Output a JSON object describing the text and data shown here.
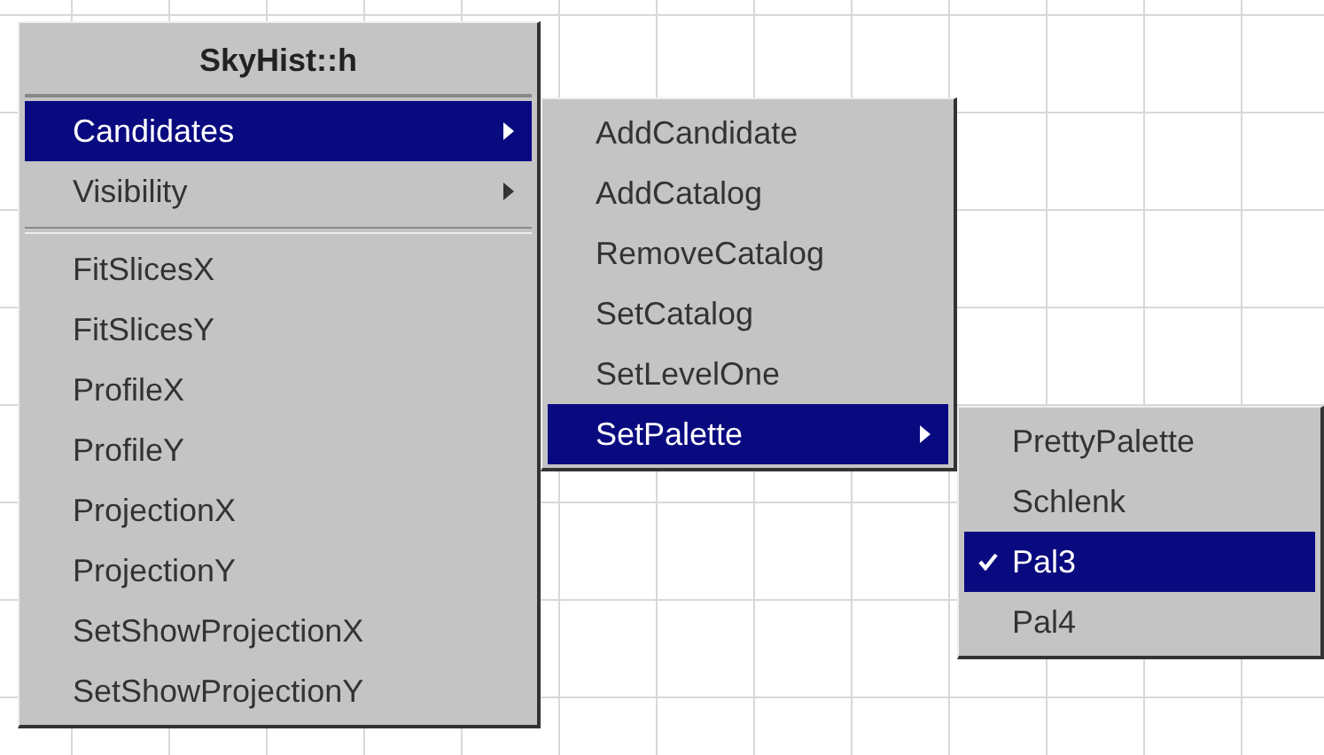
{
  "menus": [
    {
      "title": "SkyHist::h",
      "items": [
        {
          "kind": "submenu",
          "label": "Candidates",
          "selected": true
        },
        {
          "kind": "submenu",
          "label": "Visibility",
          "selected": false
        },
        {
          "kind": "separator"
        },
        {
          "kind": "command",
          "label": "FitSlicesX",
          "selected": false
        },
        {
          "kind": "command",
          "label": "FitSlicesY",
          "selected": false
        },
        {
          "kind": "command",
          "label": "ProfileX",
          "selected": false
        },
        {
          "kind": "command",
          "label": "ProfileY",
          "selected": false
        },
        {
          "kind": "command",
          "label": "ProjectionX",
          "selected": false
        },
        {
          "kind": "command",
          "label": "ProjectionY",
          "selected": false
        },
        {
          "kind": "command",
          "label": "SetShowProjectionX",
          "selected": false
        },
        {
          "kind": "command",
          "label": "SetShowProjectionY",
          "selected": false
        }
      ]
    },
    {
      "items": [
        {
          "kind": "command",
          "label": "AddCandidate",
          "selected": false
        },
        {
          "kind": "command",
          "label": "AddCatalog",
          "selected": false
        },
        {
          "kind": "command",
          "label": "RemoveCatalog",
          "selected": false
        },
        {
          "kind": "command",
          "label": "SetCatalog",
          "selected": false
        },
        {
          "kind": "command",
          "label": "SetLevelOne",
          "selected": false
        },
        {
          "kind": "submenu",
          "label": "SetPalette",
          "selected": true
        }
      ]
    },
    {
      "items": [
        {
          "kind": "check",
          "label": "PrettyPalette",
          "selected": false,
          "checked": false
        },
        {
          "kind": "check",
          "label": "Schlenk",
          "selected": false,
          "checked": false
        },
        {
          "kind": "check",
          "label": "Pal3",
          "selected": true,
          "checked": true
        },
        {
          "kind": "check",
          "label": "Pal4",
          "selected": false,
          "checked": false
        }
      ]
    }
  ]
}
